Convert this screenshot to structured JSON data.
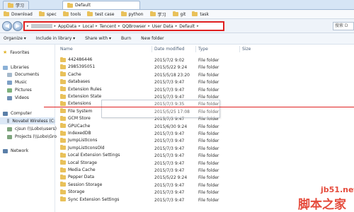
{
  "tabs": [
    {
      "label": "学习",
      "active": false
    },
    {
      "label": "Default",
      "active": true
    }
  ],
  "bookmarks": [
    "Download",
    "spec",
    "tools",
    "test case",
    "python",
    "学习",
    "git",
    "task"
  ],
  "address": {
    "segments": [
      "AppData",
      "Local",
      "Tencent",
      "QQBrowser",
      "User Data",
      "Default"
    ],
    "search_placeholder": "搜索 D"
  },
  "toolbar": {
    "organize": "Organize ▾",
    "include": "Include in library ▾",
    "share": "Share with ▾",
    "burn": "Burn",
    "new_folder": "New folder"
  },
  "nav": {
    "favorites": "Favorites",
    "libraries": "Libraries",
    "documents": "Documents",
    "music": "Music",
    "pictures": "Pictures",
    "videos": "Videos",
    "computer": "Computer",
    "novatel": "Novatel Wireless (C:",
    "cjsun": "cjsun (\\\\Lobo\\users)",
    "projects": "Projects (\\\\Lobo\\Gro",
    "network": "Network"
  },
  "columns": {
    "name": "Name",
    "date": "Date modified",
    "type": "Type",
    "size": "Size"
  },
  "files": [
    {
      "name": "442486446",
      "date": "2015/7/2 9:02",
      "type": "File folder"
    },
    {
      "name": "2985395051",
      "date": "2015/5/22 9:24",
      "type": "File folder"
    },
    {
      "name": "Cache",
      "date": "2015/5/18 23:20",
      "type": "File folder"
    },
    {
      "name": "databases",
      "date": "2015/7/3 9:47",
      "type": "File folder"
    },
    {
      "name": "Extension Rules",
      "date": "2015/7/3 9:47",
      "type": "File folder"
    },
    {
      "name": "Extension State",
      "date": "2015/7/3 9:47",
      "type": "File folder"
    },
    {
      "name": "Extensions",
      "date": "2015/7/3 9:35",
      "type": "File folder"
    },
    {
      "name": "File System",
      "date": "2015/5/25 17:08",
      "type": "File folder"
    },
    {
      "name": "GCM Store",
      "date": "2015/7/3 9:47",
      "type": "File folder"
    },
    {
      "name": "GPUCache",
      "date": "2015/6/30 9:24",
      "type": "File folder"
    },
    {
      "name": "IndexedDB",
      "date": "2015/7/3 9:47",
      "type": "File folder"
    },
    {
      "name": "JumpListIcons",
      "date": "2015/7/3 9:47",
      "type": "File folder"
    },
    {
      "name": "JumpListIconsOld",
      "date": "2015/7/3 9:47",
      "type": "File folder"
    },
    {
      "name": "Local Extension Settings",
      "date": "2015/7/3 9:47",
      "type": "File folder"
    },
    {
      "name": "Local Storage",
      "date": "2015/7/3 9:47",
      "type": "File folder"
    },
    {
      "name": "Media Cache",
      "date": "2015/7/3 9:47",
      "type": "File folder"
    },
    {
      "name": "Pepper Data",
      "date": "2015/5/22 9:24",
      "type": "File folder"
    },
    {
      "name": "Session Storage",
      "date": "2015/7/3 9:47",
      "type": "File folder"
    },
    {
      "name": "Storage",
      "date": "2015/7/3 9:47",
      "type": "File folder"
    },
    {
      "name": "Sync Extension Settings",
      "date": "2015/7/3 9:47",
      "type": "File folder"
    }
  ],
  "watermark": {
    "line1": "jb51.net",
    "line2": "脚本之家"
  },
  "colors": {
    "folder": "#e9c15a",
    "highlight": "#e02020",
    "watermark": "#e54b3c"
  }
}
